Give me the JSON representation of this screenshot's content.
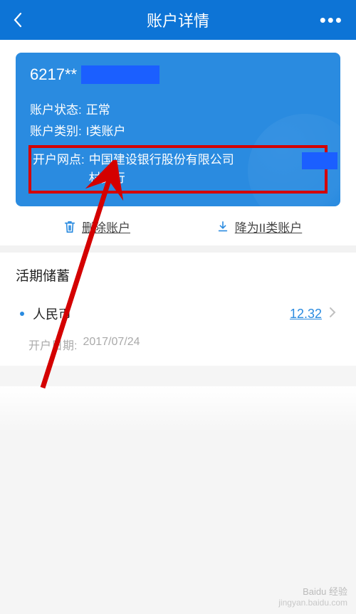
{
  "header": {
    "title": "账户详情"
  },
  "card": {
    "number_prefix": "6217**",
    "status_label": "账户状态:",
    "status_value": "正常",
    "type_label": "账户类别:",
    "type_value": "I类账户",
    "branch_label": "开户网点:",
    "branch_value_line1": "中国建设银行股份有限公司",
    "branch_value_line2": "村支行"
  },
  "actions": {
    "delete": "删除账户",
    "downgrade": "降为II类账户"
  },
  "savings": {
    "title": "活期储蓄",
    "currency_name": "人民币",
    "amount": "12.32",
    "open_date_label": "开户日期:",
    "open_date_value": "2017/07/24"
  },
  "watermark": {
    "brand": "Baidu 经验",
    "url": "jingyan.baidu.com"
  }
}
